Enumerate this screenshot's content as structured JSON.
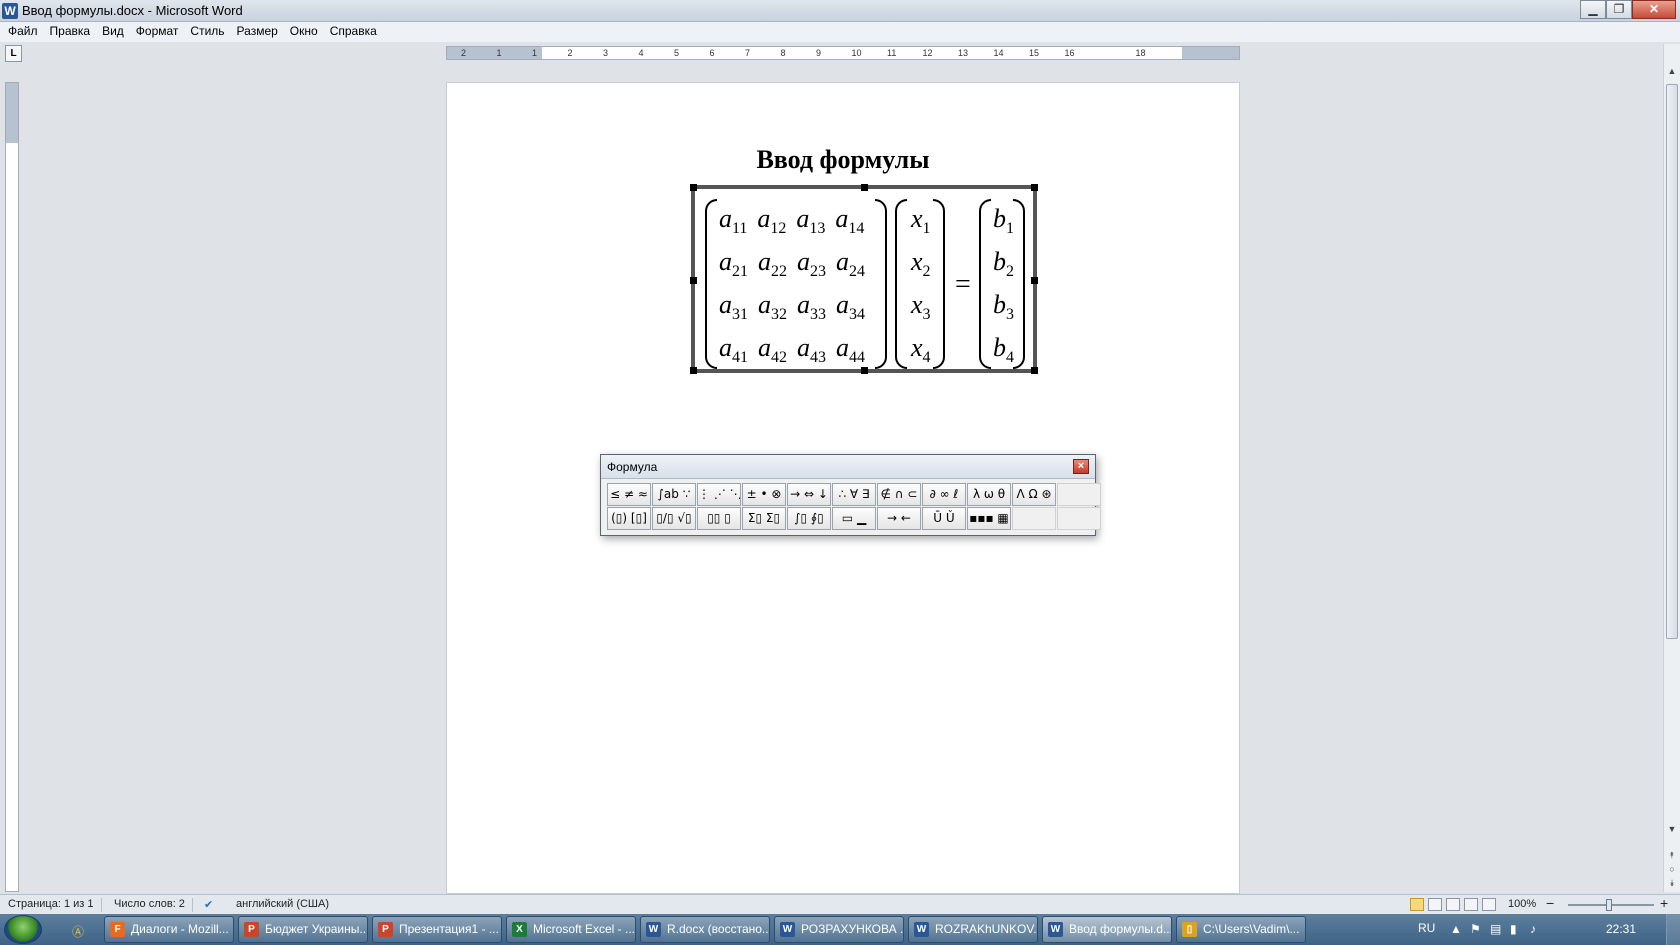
{
  "window": {
    "title": "Ввод формулы.docx - Microsoft Word",
    "background_title": "",
    "app_icon_letter": "W"
  },
  "menu": [
    "Файл",
    "Правка",
    "Вид",
    "Формат",
    "Стиль",
    "Размер",
    "Окно",
    "Справка"
  ],
  "ruler": {
    "corner_label": "L",
    "ticks": [
      "2",
      "1",
      "1",
      "2",
      "3",
      "4",
      "5",
      "6",
      "7",
      "8",
      "9",
      "10",
      "11",
      "12",
      "13",
      "14",
      "15",
      "16",
      "18"
    ]
  },
  "document": {
    "title": "Ввод формулы",
    "equation": {
      "matrix_a": [
        [
          [
            "a",
            "11"
          ],
          [
            "a",
            "12"
          ],
          [
            "a",
            "13"
          ],
          [
            "a",
            "14"
          ]
        ],
        [
          [
            "a",
            "21"
          ],
          [
            "a",
            "22"
          ],
          [
            "a",
            "23"
          ],
          [
            "a",
            "24"
          ]
        ],
        [
          [
            "a",
            "31"
          ],
          [
            "a",
            "32"
          ],
          [
            "a",
            "33"
          ],
          [
            "a",
            "34"
          ]
        ],
        [
          [
            "a",
            "41"
          ],
          [
            "a",
            "42"
          ],
          [
            "a",
            "43"
          ],
          [
            "a",
            "44"
          ]
        ]
      ],
      "vector_x": [
        [
          "x",
          "1"
        ],
        [
          "x",
          "2"
        ],
        [
          "x",
          "3"
        ],
        [
          "x",
          "4"
        ]
      ],
      "equals": "=",
      "vector_b": [
        [
          "b",
          "1"
        ],
        [
          "b",
          "2"
        ],
        [
          "b",
          "3"
        ],
        [
          "b",
          "4"
        ]
      ]
    }
  },
  "formula_toolbar": {
    "title": "Формула",
    "close_glyph": "×",
    "row1": [
      "≤ ≠ ≈",
      "∫ab ∵",
      "⋮ ⋰ ⋱",
      "± • ⊗",
      "→ ⇔ ↓",
      "∴ ∀ ∃",
      "∉ ∩ ⊂",
      "∂ ∞ ℓ",
      "λ ω θ",
      "Λ Ω ⊛",
      ""
    ],
    "row1_names": [
      "relations",
      "spaces-ellipses",
      "embellishments",
      "operators",
      "arrows",
      "logic",
      "set-theory",
      "misc-symbols",
      "greek-lower",
      "greek-upper",
      "empty"
    ],
    "row2": [
      "(▯) [▯]",
      "▯/▯ √▯",
      "▯▯ ▯",
      "Σ▯ Σ▯",
      "∫▯ ∮▯",
      "▭ ▁",
      "→ ←",
      "Ū Ǔ",
      "▪▪▪ ▦",
      "",
      ""
    ],
    "row2_names": [
      "fences",
      "fractions-radicals",
      "subscripts-superscripts",
      "summations",
      "integrals",
      "underbars-overbars",
      "labeled-arrows",
      "products-sets",
      "matrices",
      "empty",
      "empty"
    ]
  },
  "status": {
    "page": "Страница: 1 из 1",
    "words": "Число слов: 2",
    "language": "английский (США)",
    "zoom": "100%",
    "zoom_minus": "−",
    "zoom_plus": "+"
  },
  "taskbar": {
    "tasks": [
      {
        "label": "Диалоги - Mozill...",
        "icon": "firefox",
        "color": "#e66a1f",
        "letter": "F",
        "active": false
      },
      {
        "label": "Бюджет Украины...",
        "icon": "powerpoint",
        "color": "#c8462b",
        "letter": "P",
        "active": false
      },
      {
        "label": "Презентация1 - ...",
        "icon": "powerpoint",
        "color": "#c8462b",
        "letter": "P",
        "active": false
      },
      {
        "label": "Microsoft Excel - ...",
        "icon": "excel",
        "color": "#1e7b3c",
        "letter": "X",
        "active": false
      },
      {
        "label": "R.docx (восстано...",
        "icon": "word",
        "color": "#2b5797",
        "letter": "W",
        "active": false
      },
      {
        "label": "РОЗРАХУНКОВА ...",
        "icon": "word",
        "color": "#2b5797",
        "letter": "W",
        "active": false
      },
      {
        "label": "ROZRAKhUNKOV...",
        "icon": "word",
        "color": "#2b5797",
        "letter": "W",
        "active": false
      },
      {
        "label": "Ввод формулы.d...",
        "icon": "word",
        "color": "#2b5797",
        "letter": "W",
        "active": true
      },
      {
        "label": "C:\\Users\\Vadim\\...",
        "icon": "folder",
        "color": "#d9a520",
        "letter": "▯",
        "active": false
      }
    ],
    "language": "RU",
    "clock": "22:31"
  }
}
